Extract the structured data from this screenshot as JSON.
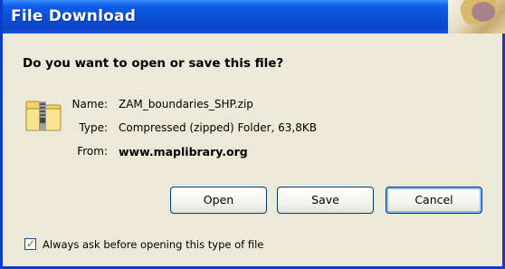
{
  "window": {
    "title": "File Download"
  },
  "dialog": {
    "question": "Do you want to open or save this file?",
    "file_icon": "zip-folder-icon",
    "fields": {
      "name_label": "Name:",
      "name_value": "ZAM_boundaries_SHP.zip",
      "type_label": "Type:",
      "type_value": "Compressed (zipped) Folder, 63,8KB",
      "from_label": "From:",
      "from_value": "www.maplibrary.org"
    },
    "buttons": {
      "open_label": "Open",
      "save_label": "Save",
      "cancel_label": "Cancel"
    },
    "checkbox": {
      "checked": true,
      "label": "Always ask before opening this type of file"
    }
  },
  "colors": {
    "titlebar": "#0B4FD6",
    "dialog_bg": "#ECE9D8",
    "button_border": "#003C74"
  }
}
